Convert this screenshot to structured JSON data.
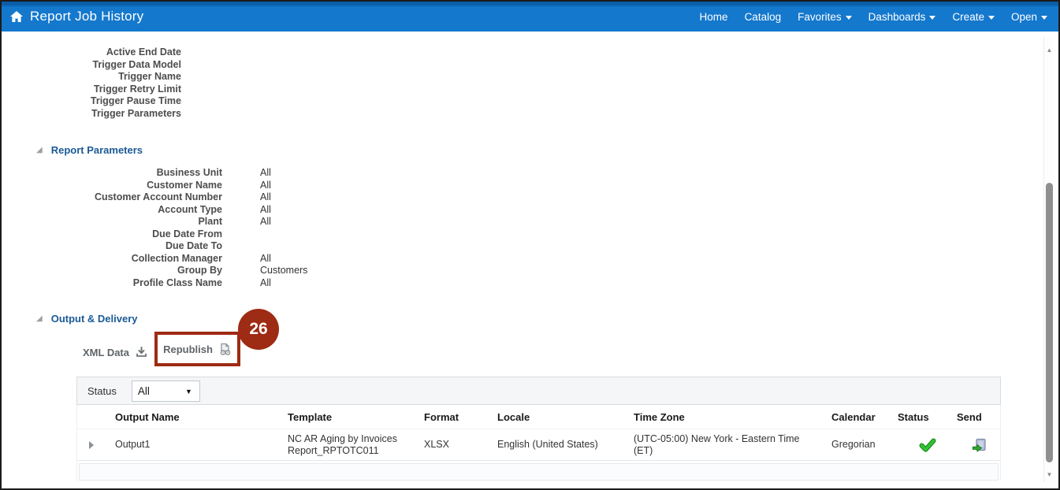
{
  "header": {
    "title": "Report Job History",
    "nav": [
      {
        "label": "Home",
        "caret": false
      },
      {
        "label": "Catalog",
        "caret": false
      },
      {
        "label": "Favorites",
        "caret": true
      },
      {
        "label": "Dashboards",
        "caret": true
      },
      {
        "label": "Create",
        "caret": true
      },
      {
        "label": "Open",
        "caret": true
      }
    ]
  },
  "trigger_fields": [
    "Active End Date",
    "Trigger Data Model",
    "Trigger Name",
    "Trigger Retry Limit",
    "Trigger Pause Time",
    "Trigger Parameters"
  ],
  "report_parameters": {
    "title": "Report Parameters",
    "rows": [
      {
        "label": "Business Unit",
        "value": "All"
      },
      {
        "label": "Customer Name",
        "value": "All"
      },
      {
        "label": "Customer Account Number",
        "value": "All"
      },
      {
        "label": "Account Type",
        "value": "All"
      },
      {
        "label": "Plant",
        "value": "All"
      },
      {
        "label": "Due Date From",
        "value": ""
      },
      {
        "label": "Due Date To",
        "value": ""
      },
      {
        "label": "Collection Manager",
        "value": "All"
      },
      {
        "label": "Group By",
        "value": "Customers"
      },
      {
        "label": "Profile Class Name",
        "value": "All"
      }
    ]
  },
  "output_delivery": {
    "title": "Output & Delivery",
    "xml_data_label": "XML Data",
    "republish_label": "Republish",
    "step_badge": "26"
  },
  "status_filter": {
    "label": "Status",
    "value": "All"
  },
  "table": {
    "columns": [
      "Output Name",
      "Template",
      "Format",
      "Locale",
      "Time Zone",
      "Calendar",
      "Status",
      "Send"
    ],
    "rows": [
      {
        "output_name": "Output1",
        "template_line1": "NC AR Aging by Invoices",
        "template_line2": "Report_RPTOTC011",
        "format": "XLSX",
        "locale": "English (United States)",
        "time_zone_line1": "(UTC-05:00) New York - Eastern Time",
        "time_zone_line2": "(ET)",
        "calendar": "Gregorian",
        "status_icon": "success-check-icon",
        "send_icon": "export-report-icon"
      }
    ]
  },
  "colors": {
    "header_blue": "#1478cd",
    "section_blue": "#1a5a96",
    "highlight_red": "#9e2b13",
    "success_green": "#2db300"
  }
}
